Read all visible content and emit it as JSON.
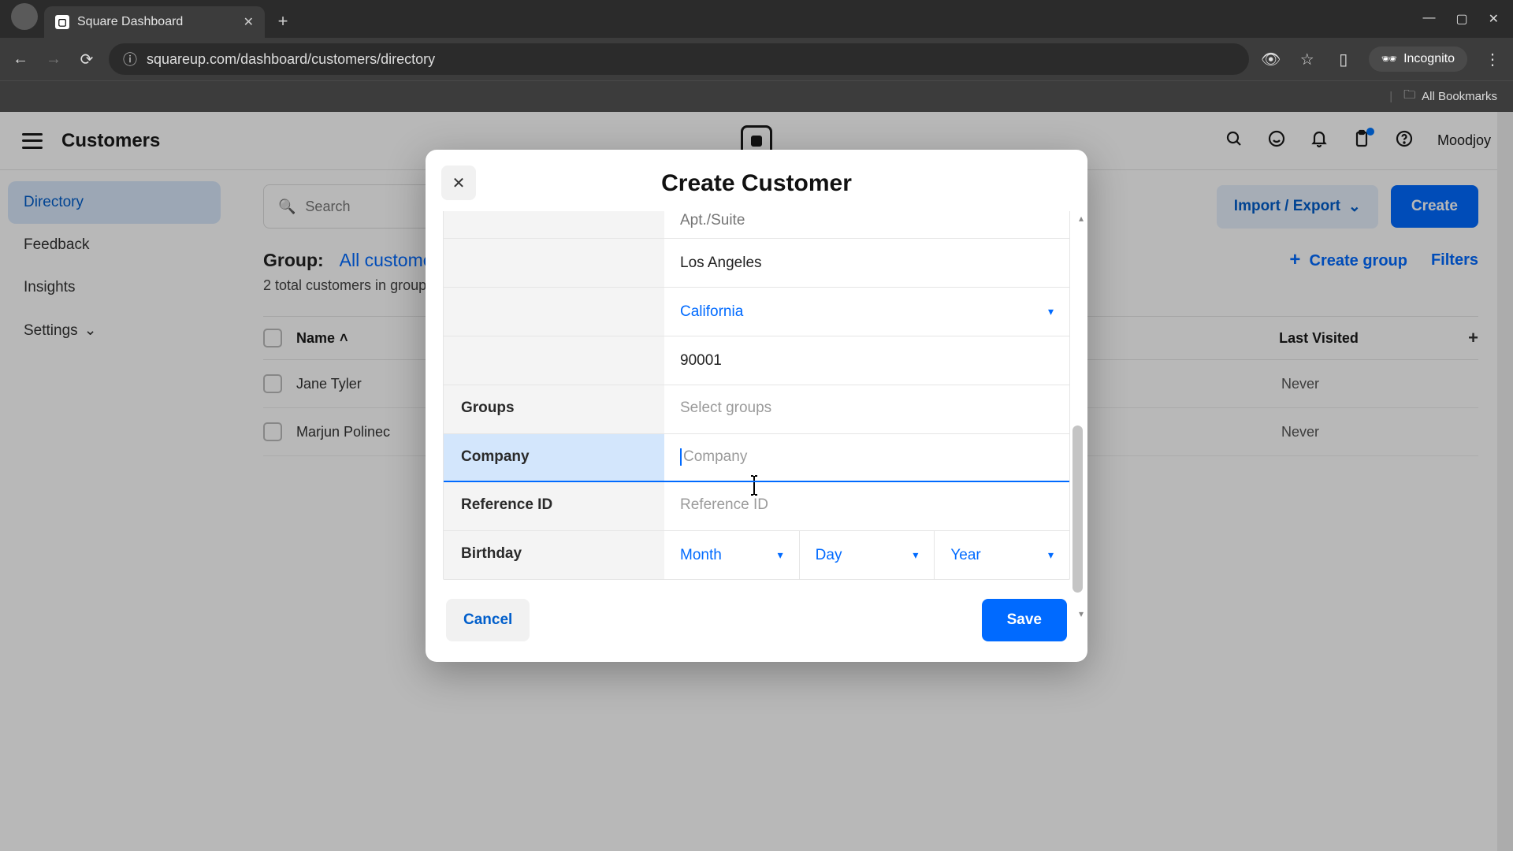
{
  "browser": {
    "tab_title": "Square Dashboard",
    "url": "squareup.com/dashboard/customers/directory",
    "incognito_label": "Incognito",
    "all_bookmarks": "All Bookmarks"
  },
  "header": {
    "section_title": "Customers",
    "user_name": "Moodjoy"
  },
  "sidebar": {
    "items": [
      {
        "label": "Directory",
        "active": true
      },
      {
        "label": "Feedback"
      },
      {
        "label": "Insights"
      },
      {
        "label": "Settings"
      }
    ]
  },
  "toolbar": {
    "search_placeholder": "Search",
    "import_export": "Import / Export",
    "create": "Create"
  },
  "group_bar": {
    "label": "Group:",
    "value": "All customers",
    "create_group": "Create group",
    "filters": "Filters"
  },
  "summary": {
    "total_line": "2 total customers in group"
  },
  "table": {
    "col_name": "Name",
    "col_last_visited": "Last Visited",
    "rows": [
      {
        "name": "Jane Tyler",
        "last_visited": "Never"
      },
      {
        "name": "Marjun Polinec",
        "last_visited": "Never"
      }
    ]
  },
  "modal": {
    "title": "Create Customer",
    "labels": {
      "groups": "Groups",
      "company": "Company",
      "reference_id": "Reference ID",
      "birthday": "Birthday"
    },
    "fields": {
      "apt_placeholder": "Apt./Suite",
      "city_value": "Los Angeles",
      "state_value": "California",
      "zip_value": "90001",
      "groups_placeholder": "Select groups",
      "company_placeholder": "Company",
      "reference_id_placeholder": "Reference ID",
      "month": "Month",
      "day": "Day",
      "year": "Year"
    },
    "buttons": {
      "cancel": "Cancel",
      "save": "Save"
    }
  }
}
